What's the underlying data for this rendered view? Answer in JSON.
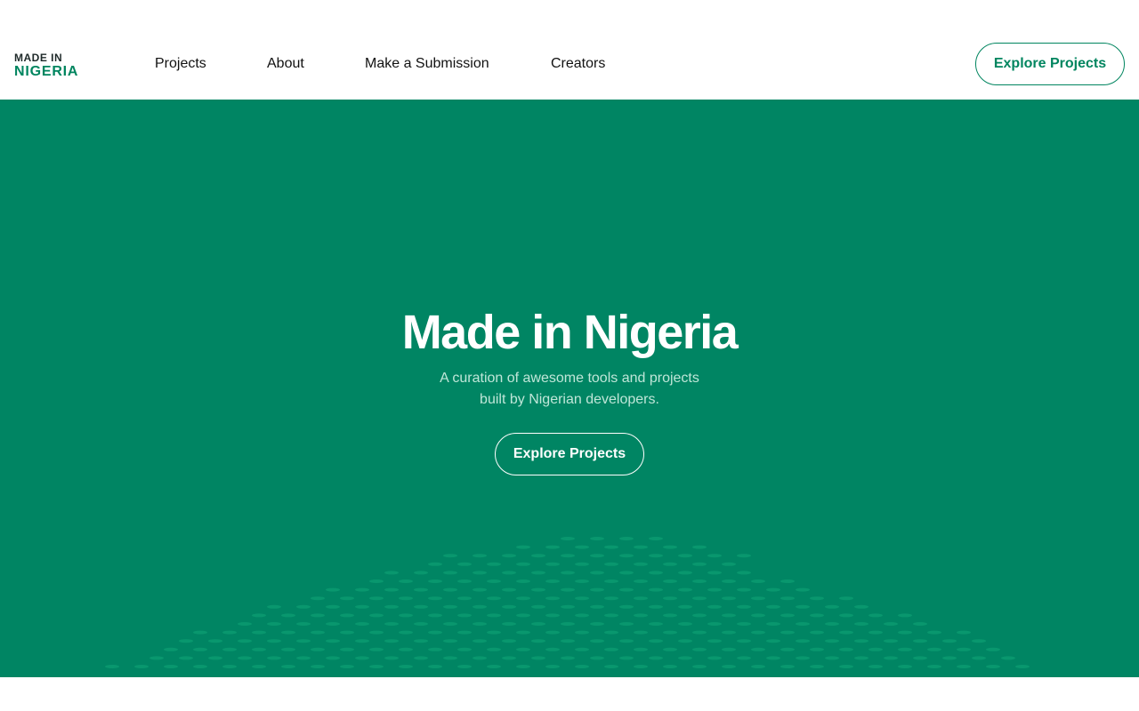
{
  "brand": {
    "logo_line1": "MADE IN",
    "logo_line2": "NIGERIA"
  },
  "nav": {
    "items": [
      {
        "label": "Projects"
      },
      {
        "label": "About"
      },
      {
        "label": "Make a Submission"
      },
      {
        "label": "Creators"
      }
    ]
  },
  "header": {
    "cta_label": "Explore Projects"
  },
  "hero": {
    "title": "Made in Nigeria",
    "subtitle_line1": "A curation of awesome tools and projects",
    "subtitle_line2": "built by Nigerian developers.",
    "cta_label": "Explore Projects"
  },
  "colors": {
    "brand_green": "#00855f",
    "hero_background": "#008563",
    "hero_subtitle": "#bfe6d8",
    "map_dots": "#0b9a70"
  },
  "decoration": {
    "map_pattern_icon": "dotted-map-icon"
  }
}
